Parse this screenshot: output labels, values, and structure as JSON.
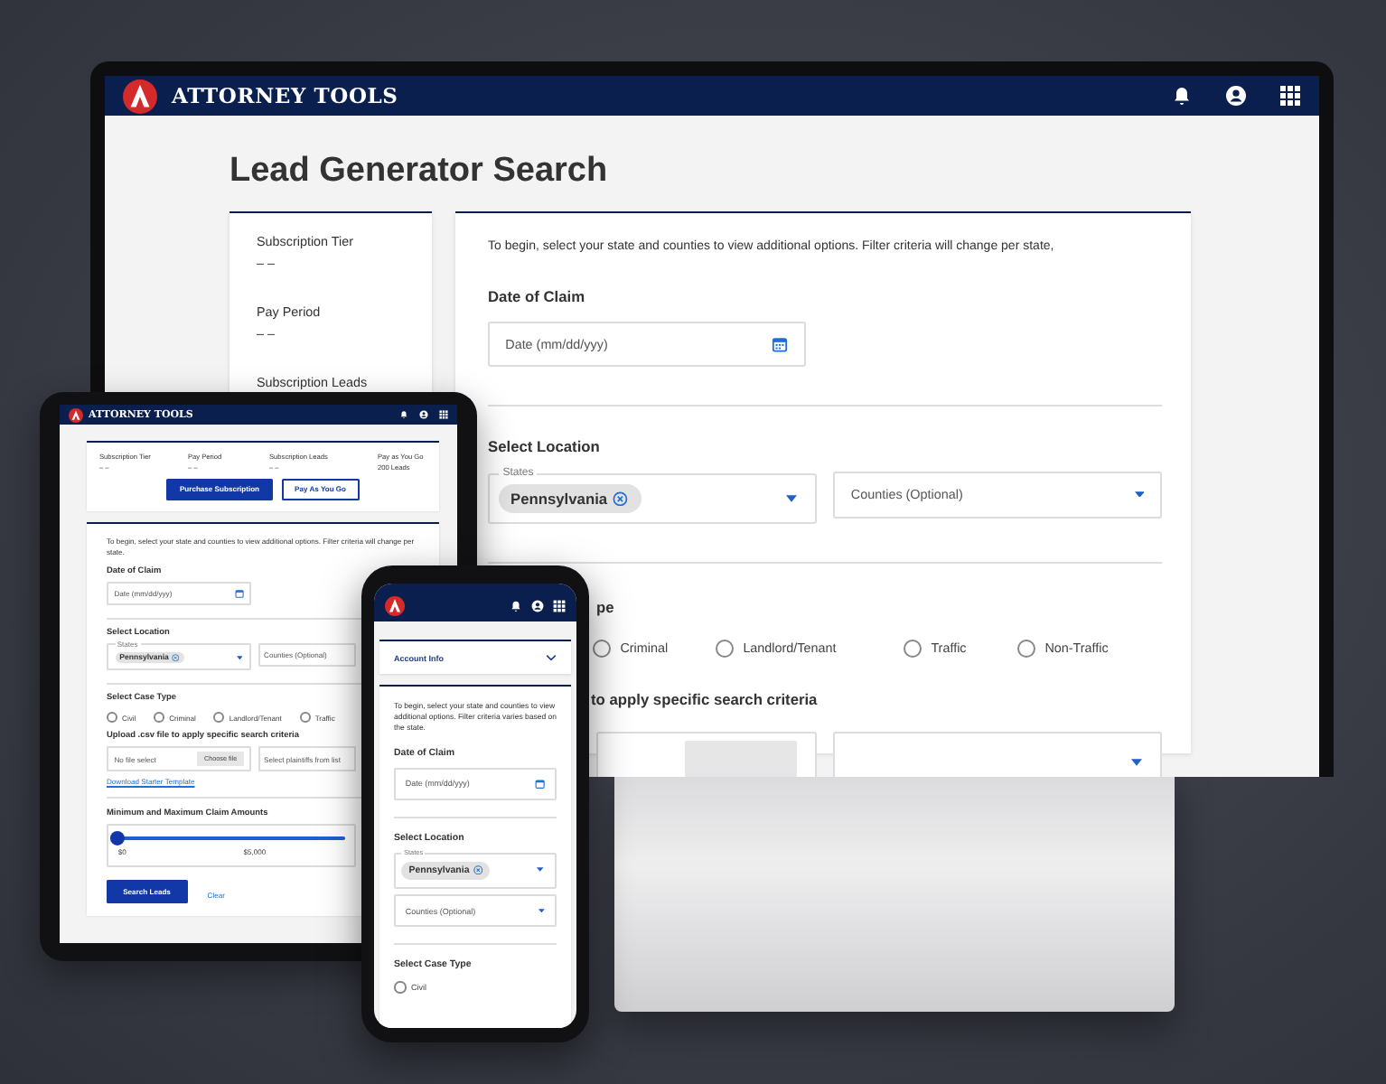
{
  "desktop": {
    "app_name": "ATTORNEY TOOLS",
    "page_title": "Lead Generator Search",
    "sidebar": [
      {
        "label": "Subscription Tier",
        "value": "– –"
      },
      {
        "label": "Pay Period",
        "value": "– –"
      },
      {
        "label": "Subscription Leads"
      }
    ],
    "intro": "To begin, select your state and counties to view additional options. Filter criteria will change per state,",
    "date": {
      "title": "Date of Claim",
      "placeholder": "Date (mm/dd/yyy)"
    },
    "location": {
      "title": "Select Location",
      "states_label": "States",
      "chip": "Pennsylvania",
      "counties_placeholder": "Counties (Optional)"
    },
    "case_type": {
      "title": "pe",
      "options": [
        {
          "label": "Criminal",
          "selected": false
        },
        {
          "label": "Landlord/Tenant",
          "selected": false
        },
        {
          "label": "Traffic",
          "selected": false
        },
        {
          "label": "Non-Traffic",
          "selected": false
        }
      ]
    },
    "upload": {
      "title": "to apply specific search criteria"
    }
  },
  "tablet": {
    "app_name": "ATTORNEY TOOLS",
    "subscription": [
      {
        "label": "Subscription Tier",
        "value": "– –"
      },
      {
        "label": "Pay Period",
        "value": "– –"
      },
      {
        "label": "Subscription Leads",
        "value": "– –"
      },
      {
        "label": "Pay as You Go",
        "value": "200 Leads"
      }
    ],
    "buttons": [
      {
        "label": "Purchase Subscription",
        "kind": "primary"
      },
      {
        "label": "Pay As You Go",
        "kind": "outline"
      }
    ],
    "intro": "To begin, select your state and counties to view additional options. Filter criteria will change per state.",
    "date": {
      "title": "Date of Claim",
      "placeholder": "Date (mm/dd/yyy)"
    },
    "location": {
      "title": "Select Location",
      "states_label": "States",
      "chip": "Pennsylvania",
      "counties_placeholder": "Counties (Optional)"
    },
    "case_type": {
      "title": "Select Case Type",
      "options": [
        {
          "label": "Civil",
          "selected": false
        },
        {
          "label": "Criminal",
          "selected": false
        },
        {
          "label": "Landlord/Tenant",
          "selected": false
        },
        {
          "label": "Traffic",
          "selected": false
        }
      ]
    },
    "upload": {
      "title": "Upload .csv file to apply specific search criteria",
      "file_placeholder": "No file select",
      "file_button": "Choose file",
      "plaintiffs_placeholder": "Select plaintiffs from list",
      "template_link": "Download Starter Template"
    },
    "claims": {
      "title": "Minimum and Maximum Claim Amounts",
      "level": 0,
      "min_label": "$0",
      "max_label": "$5,000"
    },
    "actions": {
      "search": "Search Leads",
      "clear": "Clear"
    }
  },
  "phone": {
    "account_title": "Account Info",
    "intro": "To begin, select your state and counties to view additional options. Filter criteria varies based on the state.",
    "date": {
      "title": "Date of Claim",
      "placeholder": "Date (mm/dd/yyy)"
    },
    "location": {
      "title": "Select Location",
      "states_label": "States",
      "chip": "Pennsylvania",
      "counties_placeholder": "Counties (Optional)"
    },
    "case_type": {
      "title": "Select Case Type",
      "options": [
        {
          "label": "Civil",
          "selected": false
        }
      ]
    }
  }
}
